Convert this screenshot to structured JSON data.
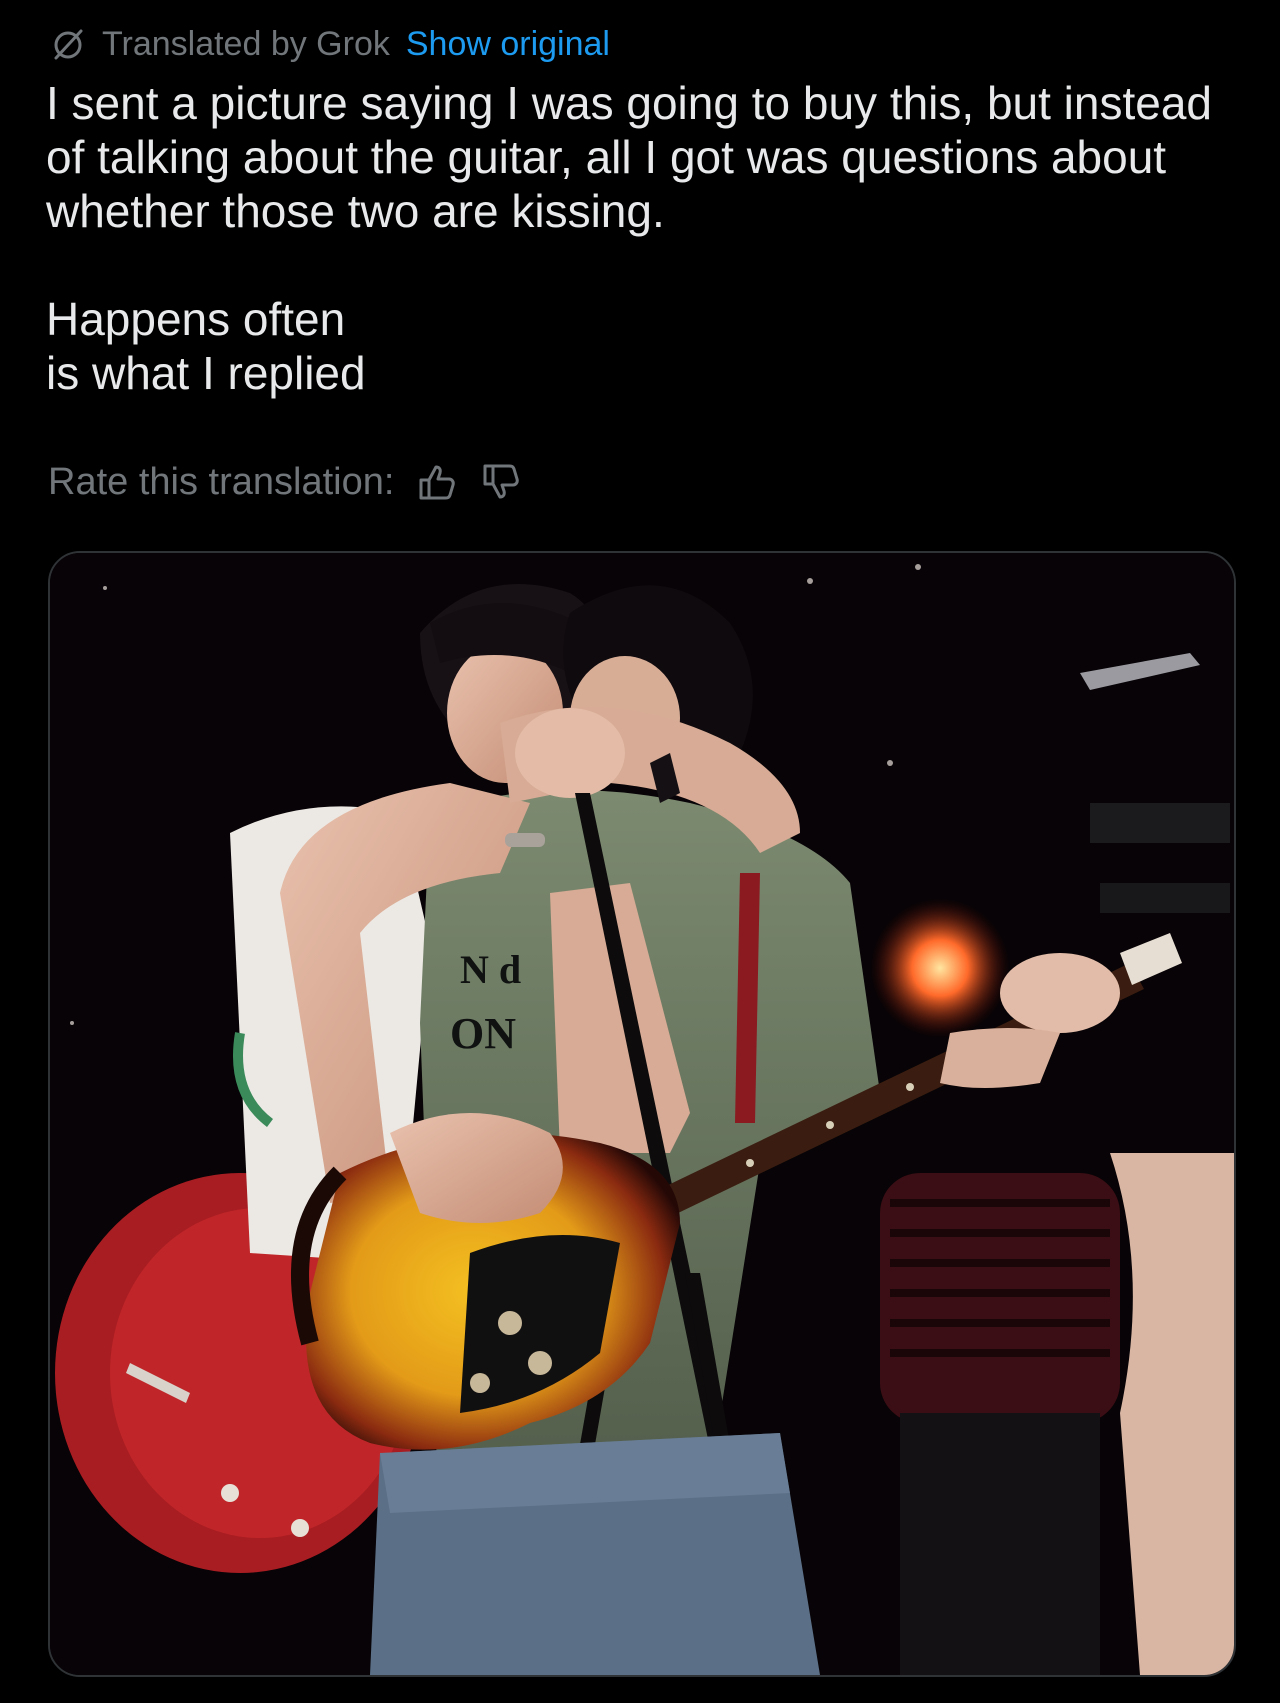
{
  "translation_bar": {
    "icon": "translate-slash-icon",
    "label": "Translated by Grok",
    "show_original": "Show original"
  },
  "tweet": {
    "paragraph1": "I sent a picture saying I was going to buy this, but instead of talking about the guitar, all I got was questions about whether those two are kissing.",
    "paragraph2_line1": "Happens often",
    "paragraph2_line2": "is what I replied"
  },
  "rating": {
    "label": "Rate this translation:",
    "thumbs_up_icon": "thumbs-up-icon",
    "thumbs_down_icon": "thumbs-down-icon"
  },
  "media": {
    "type": "photo",
    "shirt_text_1": "N d",
    "shirt_text_2": "ON"
  },
  "colors": {
    "background": "#000000",
    "text_primary": "#e7e9ea",
    "text_secondary": "#71767b",
    "link": "#1d9bf0",
    "media_border": "#2f3336"
  }
}
